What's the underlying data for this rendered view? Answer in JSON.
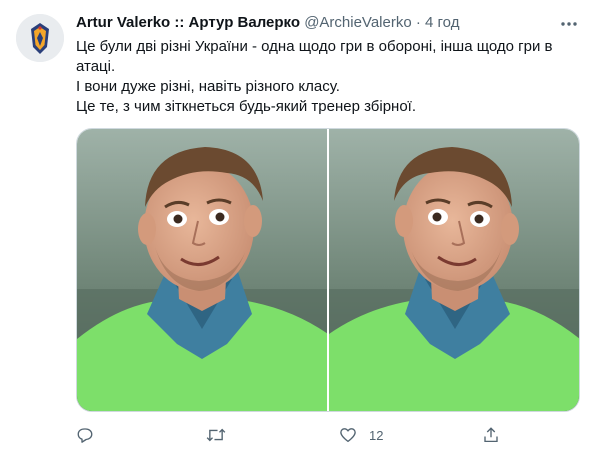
{
  "tweet": {
    "author": {
      "display_name": "Artur Valerko :: Артур Валерко",
      "handle": "@ArchieValerko",
      "separator": "·",
      "time": "4 год",
      "avatar_icon": "crest-avatar-icon"
    },
    "text_lines": [
      "Це були дві різні України - одна щодо гри в обороні, інша щодо гри в атаці.",
      "І вони дуже різні, навіть різного класу.",
      "Це те, з чим зіткнеться будь-який тренер збірної."
    ],
    "media": {
      "photos": [
        "left-photo",
        "right-photo"
      ]
    },
    "actions": {
      "reply": {
        "icon": "reply-icon",
        "count": ""
      },
      "retweet": {
        "icon": "retweet-icon",
        "count": ""
      },
      "like": {
        "icon": "heart-icon",
        "count": "12"
      },
      "share": {
        "icon": "share-icon",
        "count": ""
      }
    }
  },
  "colors": {
    "text": "#0f1419",
    "muted": "#536471",
    "border": "#cfd9de",
    "vest_green": "#7ddf6a",
    "jacket_blue": "#3f7fa0"
  }
}
